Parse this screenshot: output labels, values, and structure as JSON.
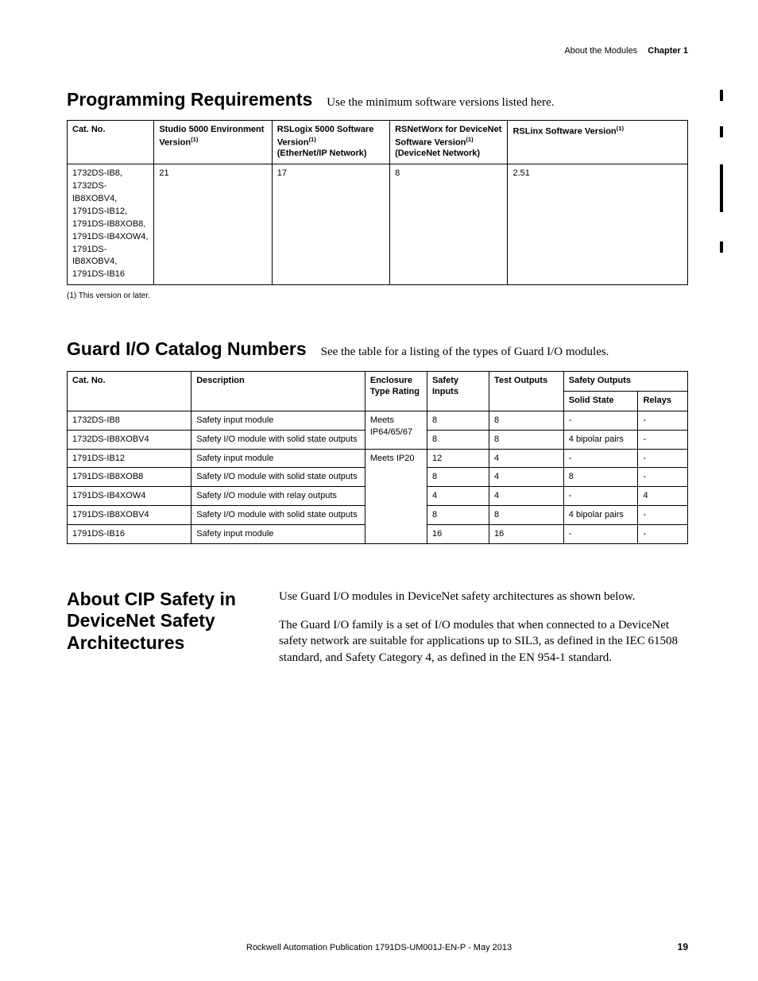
{
  "header": {
    "section": "About the Modules",
    "chapter": "Chapter 1"
  },
  "prog_req": {
    "heading": "Programming Requirements",
    "intro": "Use the minimum software versions listed here.",
    "cols": {
      "c1": "Cat. No.",
      "c2_a": "Studio 5000 Environment Version",
      "c3_a": "RSLogix 5000 Software Version",
      "c3_b": "(EtherNet/IP Network)",
      "c4_a": "RSNetWorx for DeviceNet Software Version",
      "c4_b": "(DeviceNet Network)",
      "c5_a": "RSLinx Software Version"
    },
    "row": {
      "cat": "1732DS-IB8,\n1732DS-IB8XOBV4,\n1791DS-IB12,\n1791DS-IB8XOB8,\n1791DS-IB4XOW4,\n1791DS-IB8XOBV4,\n1791DS-IB16",
      "studio": "21",
      "rslogix": "17",
      "rsnetworx": "8",
      "rslinx": "2.51"
    },
    "footnote": "(1)   This version or later."
  },
  "guard": {
    "heading": "Guard I/O Catalog Numbers",
    "intro": "See the table for a listing of the types of Guard I/O modules.",
    "cols": {
      "cat": "Cat. No.",
      "desc": "Description",
      "enc": "Enclosure Type Rating",
      "si": "Safety Inputs",
      "to": "Test Outputs",
      "so": "Safety Outputs",
      "ss": "Solid State",
      "re": "Relays"
    },
    "enc_a": "Meets IP64/65/67",
    "enc_b": "Meets IP20",
    "rows": [
      {
        "cat": "1732DS-IB8",
        "desc": "Safety input module",
        "si": "8",
        "to": "8",
        "ss": "-",
        "re": "-"
      },
      {
        "cat": "1732DS-IB8XOBV4",
        "desc": "Safety I/O module with solid state outputs",
        "si": "8",
        "to": "8",
        "ss": "4 bipolar pairs",
        "re": "-"
      },
      {
        "cat": "1791DS-IB12",
        "desc": "Safety input module",
        "si": "12",
        "to": "4",
        "ss": "-",
        "re": "-"
      },
      {
        "cat": "1791DS-IB8XOB8",
        "desc": "Safety I/O module with solid state outputs",
        "si": "8",
        "to": "4",
        "ss": "8",
        "re": "-"
      },
      {
        "cat": "1791DS-IB4XOW4",
        "desc": "Safety I/O module with relay outputs",
        "si": "4",
        "to": "4",
        "ss": "-",
        "re": "4"
      },
      {
        "cat": "1791DS-IB8XOBV4",
        "desc": "Safety I/O module with solid state outputs",
        "si": "8",
        "to": "8",
        "ss": "4 bipolar pairs",
        "re": "-"
      },
      {
        "cat": "1791DS-IB16",
        "desc": "Safety input module",
        "si": "16",
        "to": "16",
        "ss": "-",
        "re": "-"
      }
    ]
  },
  "cip": {
    "heading": "About CIP Safety in DeviceNet Safety Architectures",
    "p1": "Use Guard I/O modules in DeviceNet safety architectures as shown below.",
    "p2": "The Guard I/O family is a set of I/O modules that when connected to a DeviceNet safety network are suitable for applications up to SIL3, as defined in the IEC 61508 standard, and Safety Category 4, as defined in the EN 954-1 standard."
  },
  "footer": {
    "pub": "Rockwell Automation Publication 1791DS-UM001J-EN-P - May 2013",
    "page": "19"
  },
  "sup1": "(1)"
}
